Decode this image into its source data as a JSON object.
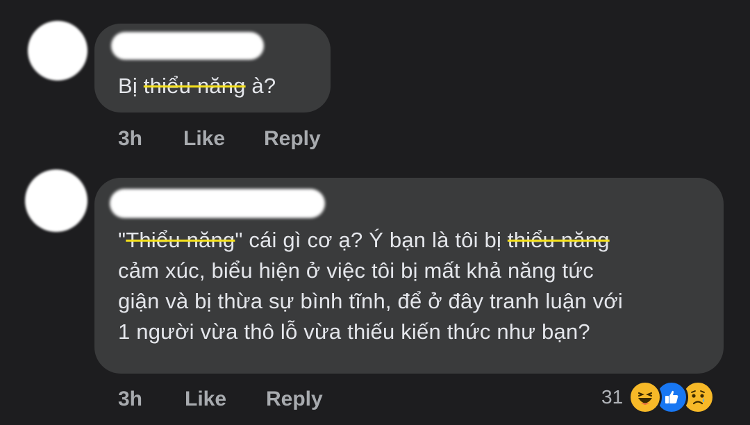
{
  "comments": [
    {
      "segments": [
        {
          "text": "Bị ",
          "strike": false
        },
        {
          "text": "thiểu năng",
          "strike": true
        },
        {
          "text": " à?",
          "strike": false
        }
      ],
      "time": "3h",
      "like_label": "Like",
      "reply_label": "Reply"
    },
    {
      "lines": [
        [
          {
            "text": "\"",
            "strike": false
          },
          {
            "text": "Thiểu năng",
            "strike": true
          },
          {
            "text": "\" cái gì cơ ạ? Ý bạn là tôi bị ",
            "strike": false
          },
          {
            "text": "thiểu năng",
            "strike": true
          }
        ],
        [
          {
            "text": "cảm xúc, biểu hiện ở việc tôi bị mất khả năng tức",
            "strike": false
          }
        ],
        [
          {
            "text": "giận và bị thừa sự bình tĩnh, để ở đây tranh luận với",
            "strike": false
          }
        ],
        [
          {
            "text": "1 người vừa thô lỗ vừa thiếu kiến thức như bạn?",
            "strike": false
          }
        ]
      ],
      "time": "3h",
      "like_label": "Like",
      "reply_label": "Reply",
      "reaction_count": "31",
      "reactions": [
        "haha-icon",
        "like-icon",
        "sad-icon"
      ]
    }
  ],
  "colors": {
    "background": "#1d1d1f",
    "bubble": "#3a3b3c",
    "text": "#e4e6eb",
    "meta": "#a8abaf",
    "strike": "#f5e11c",
    "like_blue": "#1877f2",
    "emoji_yellow": "#f7b928"
  }
}
